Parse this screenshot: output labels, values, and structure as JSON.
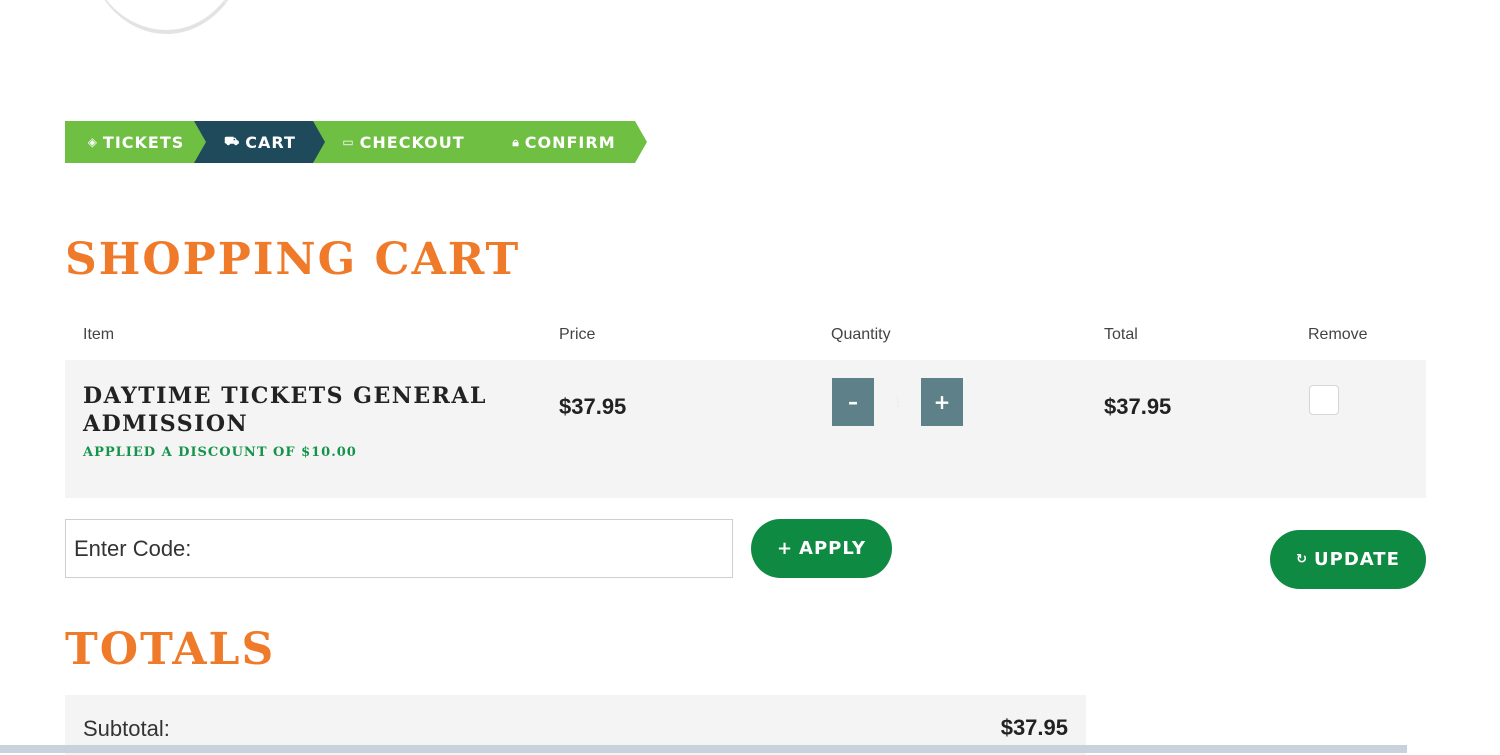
{
  "breadcrumb": {
    "steps": [
      {
        "label": "TICKETS",
        "icon": "tag-icon",
        "glyph": "🏷"
      },
      {
        "label": "CART",
        "icon": "cart-icon",
        "glyph": "🛒"
      },
      {
        "label": "CHECKOUT",
        "icon": "card-icon",
        "glyph": "▭"
      },
      {
        "label": "CONFIRM",
        "icon": "lock-icon",
        "glyph": "🔒"
      }
    ],
    "active_step": "CART",
    "colors": {
      "inactive": "#6fbf43",
      "active": "#1f4a5c"
    }
  },
  "cart": {
    "title": "SHOPPING CART",
    "columns": {
      "item": "Item",
      "price": "Price",
      "quantity": "Quantity",
      "total": "Total",
      "remove": "Remove"
    },
    "items": [
      {
        "name": "DAYTIME TICKETS GENERAL ADMISSION",
        "discount": "APPLIED A DISCOUNT OF $10.00",
        "price": "$37.95",
        "quantity": "1",
        "total": "$37.95",
        "remove": false
      }
    ],
    "qty_minus": "–",
    "qty_plus": "+"
  },
  "promo": {
    "placeholder": "Enter Code:",
    "apply_label": "APPLY",
    "apply_icon": "+",
    "update_label": "UPDATE",
    "update_icon": "↻"
  },
  "totals": {
    "title": "TOTALS",
    "subtotal_label": "Subtotal:",
    "subtotal_value": "$37.95"
  },
  "colors": {
    "heading": "#ef7b2a",
    "button": "#0f8a43",
    "discount": "#14944a",
    "qty_button": "#5e8189"
  }
}
